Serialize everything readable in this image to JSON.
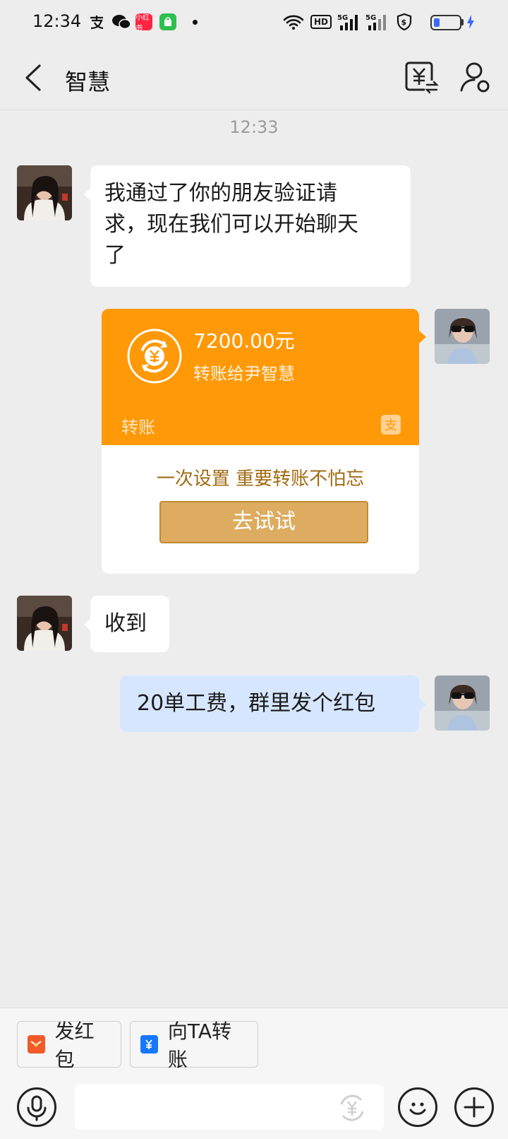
{
  "status_bar": {
    "time": "12:34",
    "mini_app_label": "小红书",
    "hd_label": "HD",
    "net_label_1": "5G",
    "net_label_2": "5G"
  },
  "header": {
    "title": "智慧"
  },
  "chat": {
    "timestamp": "12:33",
    "messages": [
      {
        "side": "left",
        "text": "我通过了你的朋友验证请求，现在我们可以开始聊天了",
        "lines": [
          "我通过了你的朋友验证请",
          "求，现在我们可以开始聊天",
          "了"
        ]
      },
      {
        "side": "right",
        "type": "transfer"
      },
      {
        "side": "left",
        "text": "收到"
      },
      {
        "side": "right",
        "text": "20单工费，群里发个红包"
      }
    ],
    "transfer": {
      "amount": "7200.00元",
      "recipient_line": "转账给尹智慧",
      "label": "转账",
      "promo": "一次设置 重要转账不怕忘",
      "try_button": "去试试",
      "logo_glyph": "支"
    }
  },
  "bottom": {
    "red_packet_label": "发红包",
    "transfer_label": "向TA转账"
  },
  "colors": {
    "accent_orange": "#ff9908",
    "bubble_blue": "#d6e6ff",
    "try_button": "#ddac60",
    "background": "#ededed"
  },
  "icons": [
    "back-arrow-icon",
    "bill-icon",
    "contact-settings-icon",
    "yuan-coin-icon",
    "alipay-logo-icon",
    "red-packet-icon",
    "transfer-card-icon",
    "microphone-icon",
    "money-icon",
    "emoji-icon",
    "plus-icon"
  ]
}
